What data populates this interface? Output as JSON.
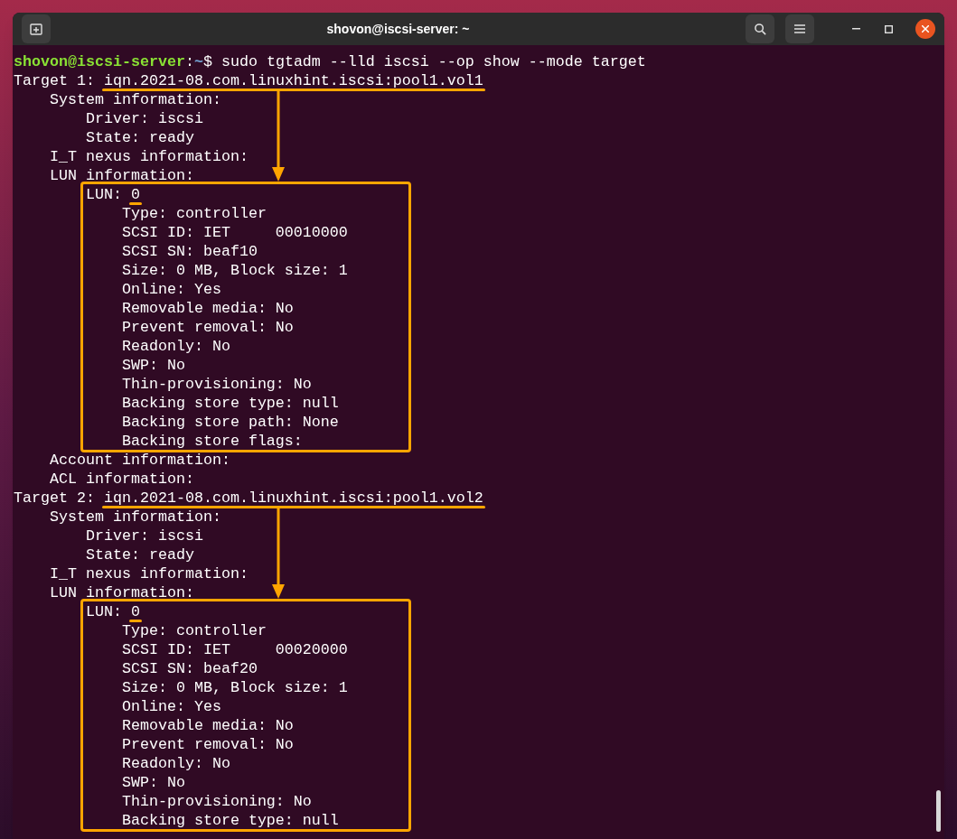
{
  "window": {
    "title": "shovon@iscsi-server: ~"
  },
  "terminal": {
    "blocks": [
      {
        "kind": "plain",
        "lines": [
          {
            "segments": [
              {
                "kind": "user",
                "text": "shovon@iscsi-server"
              },
              {
                "kind": "text",
                "text": ":"
              },
              {
                "kind": "path",
                "text": "~"
              },
              {
                "kind": "text",
                "text": "$ sudo tgtadm --lld iscsi --op show --mode target"
              }
            ]
          },
          {
            "segments": [
              {
                "kind": "text",
                "text": "Target 1: "
              },
              {
                "kind": "text",
                "text": "iqn.2021-08.com.linuxhint.iscsi:pool1.vol1",
                "underlined": true
              }
            ]
          },
          {
            "segments": [
              {
                "kind": "text",
                "text": "    System information:"
              }
            ]
          },
          {
            "segments": [
              {
                "kind": "text",
                "text": "        Driver: iscsi"
              }
            ]
          },
          {
            "segments": [
              {
                "kind": "text",
                "text": "        State: ready"
              }
            ]
          },
          {
            "segments": [
              {
                "kind": "text",
                "text": "    I_T nexus information:"
              }
            ]
          },
          {
            "segments": [
              {
                "kind": "text",
                "text": "    LUN information:"
              }
            ]
          }
        ]
      },
      {
        "kind": "box",
        "lines": [
          {
            "segments": [
              {
                "kind": "text",
                "text": "        LUN: "
              },
              {
                "kind": "text",
                "text": "0",
                "underlined": true
              }
            ]
          },
          {
            "segments": [
              {
                "kind": "text",
                "text": "            Type: controller"
              }
            ]
          },
          {
            "segments": [
              {
                "kind": "text",
                "text": "            SCSI ID: IET     00010000"
              }
            ]
          },
          {
            "segments": [
              {
                "kind": "text",
                "text": "            SCSI SN: beaf10"
              }
            ]
          },
          {
            "segments": [
              {
                "kind": "text",
                "text": "            Size: 0 MB, Block size: 1"
              }
            ]
          },
          {
            "segments": [
              {
                "kind": "text",
                "text": "            Online: Yes"
              }
            ]
          },
          {
            "segments": [
              {
                "kind": "text",
                "text": "            Removable media: No"
              }
            ]
          },
          {
            "segments": [
              {
                "kind": "text",
                "text": "            Prevent removal: No"
              }
            ]
          },
          {
            "segments": [
              {
                "kind": "text",
                "text": "            Readonly: No"
              }
            ]
          },
          {
            "segments": [
              {
                "kind": "text",
                "text": "            SWP: No"
              }
            ]
          },
          {
            "segments": [
              {
                "kind": "text",
                "text": "            Thin-provisioning: No"
              }
            ]
          },
          {
            "segments": [
              {
                "kind": "text",
                "text": "            Backing store type: null"
              }
            ]
          },
          {
            "segments": [
              {
                "kind": "text",
                "text": "            Backing store path: None"
              }
            ]
          },
          {
            "segments": [
              {
                "kind": "text",
                "text": "            Backing store flags:"
              }
            ]
          }
        ]
      },
      {
        "kind": "plain",
        "lines": [
          {
            "segments": [
              {
                "kind": "text",
                "text": "    Account information:"
              }
            ]
          },
          {
            "segments": [
              {
                "kind": "text",
                "text": "    ACL information:"
              }
            ]
          },
          {
            "segments": [
              {
                "kind": "text",
                "text": "Target 2: "
              },
              {
                "kind": "text",
                "text": "iqn.2021-08.com.linuxhint.iscsi:pool1.vol2",
                "underlined": true
              }
            ]
          },
          {
            "segments": [
              {
                "kind": "text",
                "text": "    System information:"
              }
            ]
          },
          {
            "segments": [
              {
                "kind": "text",
                "text": "        Driver: iscsi"
              }
            ]
          },
          {
            "segments": [
              {
                "kind": "text",
                "text": "        State: ready"
              }
            ]
          },
          {
            "segments": [
              {
                "kind": "text",
                "text": "    I_T nexus information:"
              }
            ]
          },
          {
            "segments": [
              {
                "kind": "text",
                "text": "    LUN information:"
              }
            ]
          }
        ]
      },
      {
        "kind": "box",
        "lines": [
          {
            "segments": [
              {
                "kind": "text",
                "text": "        LUN: "
              },
              {
                "kind": "text",
                "text": "0",
                "underlined": true
              }
            ]
          },
          {
            "segments": [
              {
                "kind": "text",
                "text": "            Type: controller"
              }
            ]
          },
          {
            "segments": [
              {
                "kind": "text",
                "text": "            SCSI ID: IET     00020000"
              }
            ]
          },
          {
            "segments": [
              {
                "kind": "text",
                "text": "            SCSI SN: beaf20"
              }
            ]
          },
          {
            "segments": [
              {
                "kind": "text",
                "text": "            Size: 0 MB, Block size: 1"
              }
            ]
          },
          {
            "segments": [
              {
                "kind": "text",
                "text": "            Online: Yes"
              }
            ]
          },
          {
            "segments": [
              {
                "kind": "text",
                "text": "            Removable media: No"
              }
            ]
          },
          {
            "segments": [
              {
                "kind": "text",
                "text": "            Prevent removal: No"
              }
            ]
          },
          {
            "segments": [
              {
                "kind": "text",
                "text": "            Readonly: No"
              }
            ]
          },
          {
            "segments": [
              {
                "kind": "text",
                "text": "            SWP: No"
              }
            ]
          },
          {
            "segments": [
              {
                "kind": "text",
                "text": "            Thin-provisioning: No"
              }
            ]
          },
          {
            "segments": [
              {
                "kind": "text",
                "text": "            Backing store type: null"
              }
            ]
          }
        ]
      }
    ]
  }
}
